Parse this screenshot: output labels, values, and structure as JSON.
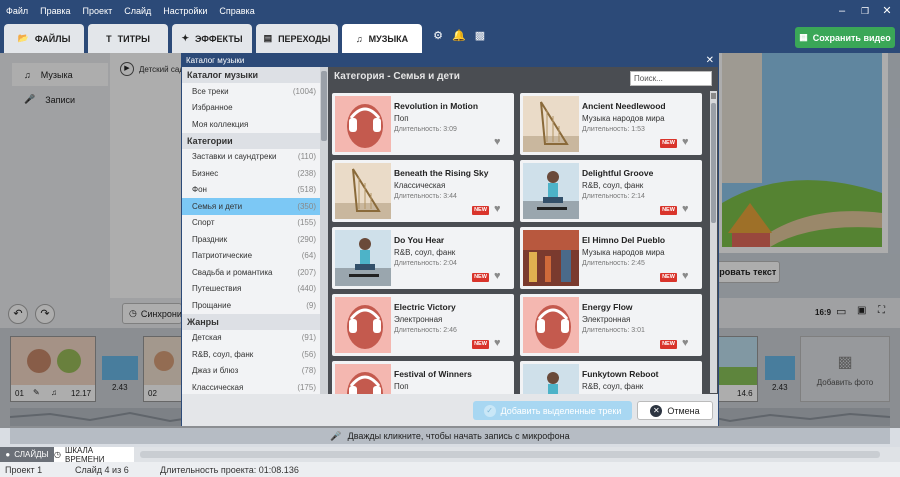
{
  "menu": [
    "Файл",
    "Правка",
    "Проект",
    "Слайд",
    "Настройки",
    "Справка"
  ],
  "tabs": {
    "files": "ФАЙЛЫ",
    "titles": "ТИТРЫ",
    "effects": "ЭФФЕКТЫ",
    "transitions": "ПЕРЕХОДЫ",
    "music": "МУЗЫКА"
  },
  "save_label": "Сохранить видео",
  "side": {
    "music": "Музыка",
    "records": "Записи"
  },
  "main": {
    "track_label": "Детский сад"
  },
  "preview": {
    "edit_text_button": "ировать текст",
    "aspect": "16:9"
  },
  "controls": {
    "sync_label": "Синхрони"
  },
  "timeline": {
    "slide1": {
      "num": "01",
      "dur": "12.17"
    },
    "slide1_trans": "2.43",
    "slide2": {
      "num": "02"
    },
    "right_trans": "2.43",
    "right_dur": "14.6",
    "add_photo": "Добавить фото"
  },
  "mic_hint": "Дважды кликните, чтобы начать запись с микрофона",
  "bottom_tabs": {
    "slides": "СЛАЙДЫ",
    "timeline": "ШКАЛА ВРЕМЕНИ"
  },
  "status": {
    "project": "Проект 1",
    "slide": "Слайд 4 из 6",
    "duration": "Длительность проекта: 01:08.136"
  },
  "modal": {
    "title": "Каталог музыки",
    "section_catalog": "Каталог музыки",
    "catalog_items": [
      {
        "label": "Все треки",
        "count": "(1004)"
      },
      {
        "label": "Избранное",
        "count": ""
      },
      {
        "label": "Моя коллекция",
        "count": ""
      }
    ],
    "section_categories": "Категории",
    "category_items": [
      {
        "label": "Заставки и саундтреки",
        "count": "(110)"
      },
      {
        "label": "Бизнес",
        "count": "(238)"
      },
      {
        "label": "Фон",
        "count": "(518)"
      },
      {
        "label": "Семья и дети",
        "count": "(350)"
      },
      {
        "label": "Спорт",
        "count": "(155)"
      },
      {
        "label": "Праздник",
        "count": "(290)"
      },
      {
        "label": "Патриотические",
        "count": "(64)"
      },
      {
        "label": "Свадьба и романтика",
        "count": "(207)"
      },
      {
        "label": "Путешествия",
        "count": "(440)"
      },
      {
        "label": "Прощание",
        "count": "(9)"
      }
    ],
    "section_genres": "Жанры",
    "genre_items": [
      {
        "label": "Детская",
        "count": "(91)"
      },
      {
        "label": "R&B, соул, фанк",
        "count": "(56)"
      },
      {
        "label": "Джаз и блюз",
        "count": "(78)"
      },
      {
        "label": "Классическая",
        "count": "(175)"
      }
    ],
    "category_title": "Категория - Семья и дети",
    "search_placeholder": "Поиск...",
    "tracks": [
      {
        "name": "Revolution in Motion",
        "genre": "Поп",
        "duration": "Длительность: 3:09",
        "new": false,
        "thumb": "headphones"
      },
      {
        "name": "Ancient Needlewood",
        "genre": "Музыка народов мира",
        "duration": "Длительность: 1:53",
        "new": true,
        "thumb": "harp"
      },
      {
        "name": "Beneath the Rising Sky",
        "genre": "Классическая",
        "duration": "Длительность: 3:44",
        "new": true,
        "thumb": "harp"
      },
      {
        "name": "Delightful Groove",
        "genre": "R&B, соул, фанк",
        "duration": "Длительность: 2:14",
        "new": true,
        "thumb": "skater"
      },
      {
        "name": "Do You Hear",
        "genre": "R&B, соул, фанк",
        "duration": "Длительность: 2:04",
        "new": true,
        "thumb": "skater"
      },
      {
        "name": "El Himno Del Pueblo",
        "genre": "Музыка народов мира",
        "duration": "Длительность: 2:45",
        "new": true,
        "thumb": "street"
      },
      {
        "name": "Electric Victory",
        "genre": "Электронная",
        "duration": "Длительность: 2:46",
        "new": true,
        "thumb": "headphones"
      },
      {
        "name": "Energy Flow",
        "genre": "Электронная",
        "duration": "Длительность: 3:01",
        "new": true,
        "thumb": "headphones"
      },
      {
        "name": "Festival of Winners",
        "genre": "Поп",
        "duration": "Длительность: 2:22",
        "new": false,
        "thumb": "headphones"
      },
      {
        "name": "Funkytown Reboot",
        "genre": "R&B, соул, фанк",
        "duration": "Длительность: 3:10",
        "new": false,
        "thumb": "skater"
      }
    ],
    "new_badge": "NEW",
    "add_button": "Добавить выделенные треки",
    "cancel_button": "Отмена"
  },
  "colors": {
    "header": "#2c4a78",
    "save": "#3aa757",
    "selected": "#7cc8f5",
    "new_badge": "#d9342b",
    "add_button": "#a8d7f2"
  }
}
